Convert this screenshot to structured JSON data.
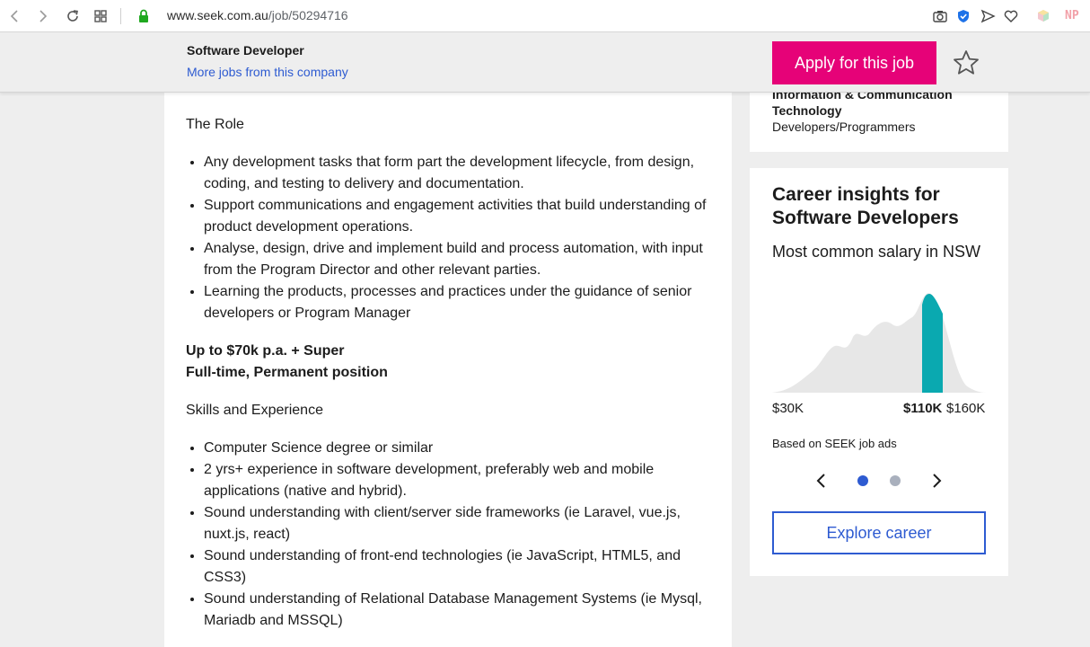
{
  "browser": {
    "url_host": "www.seek.com.au",
    "url_path": "/job/50294716",
    "ext_label": "NP"
  },
  "header": {
    "job_title": "Software Developer",
    "more_jobs_link": "More jobs from this company",
    "apply_label": "Apply for this job"
  },
  "job": {
    "section_role": "The Role",
    "role_items": [
      "Any development tasks that form part the development lifecycle, from design, coding, and testing to delivery and documentation.",
      "Support communications and engagement activities that build understanding of product development operations.",
      "Analyse, design, drive and implement build and process automation, with input from the Program Director and other relevant parties.",
      "Learning the products, processes and practices under the guidance of senior developers or Program Manager"
    ],
    "salary_line": "Up to $70k p.a. + Super",
    "type_line": "Full-time, Permanent position",
    "section_skills": "Skills and Experience",
    "skill_items": [
      "Computer Science degree or similar",
      "2 yrs+ experience in software development, preferably web and mobile applications (native and hybrid).",
      "Sound understanding with client/server side frameworks (ie Laravel, vue.js, nuxt.js, react)",
      "Sound understanding of front-end technologies (ie JavaScript, HTML5, and CSS3)",
      "Sound understanding of Relational Database Management Systems (ie Mysql, Mariadb and MSSQL)"
    ]
  },
  "classification": {
    "category_line1": "Information & Communication",
    "category_line2": "Technology",
    "subcategory": "Developers/Programmers"
  },
  "career": {
    "title": "Career insights for Software Developers",
    "subtitle": "Most common salary in NSW",
    "salary_min": "$30K",
    "salary_common": "$110K",
    "salary_max": "$160K",
    "based_on": "Based on SEEK job ads",
    "carousel_active_index": 0,
    "carousel_count": 2,
    "explore_label": "Explore career"
  },
  "colors": {
    "accent_pink": "#e60278",
    "link_blue": "#2e5bd1",
    "chart_teal": "#0aa9b0",
    "chart_grey": "#e7e7e7"
  }
}
